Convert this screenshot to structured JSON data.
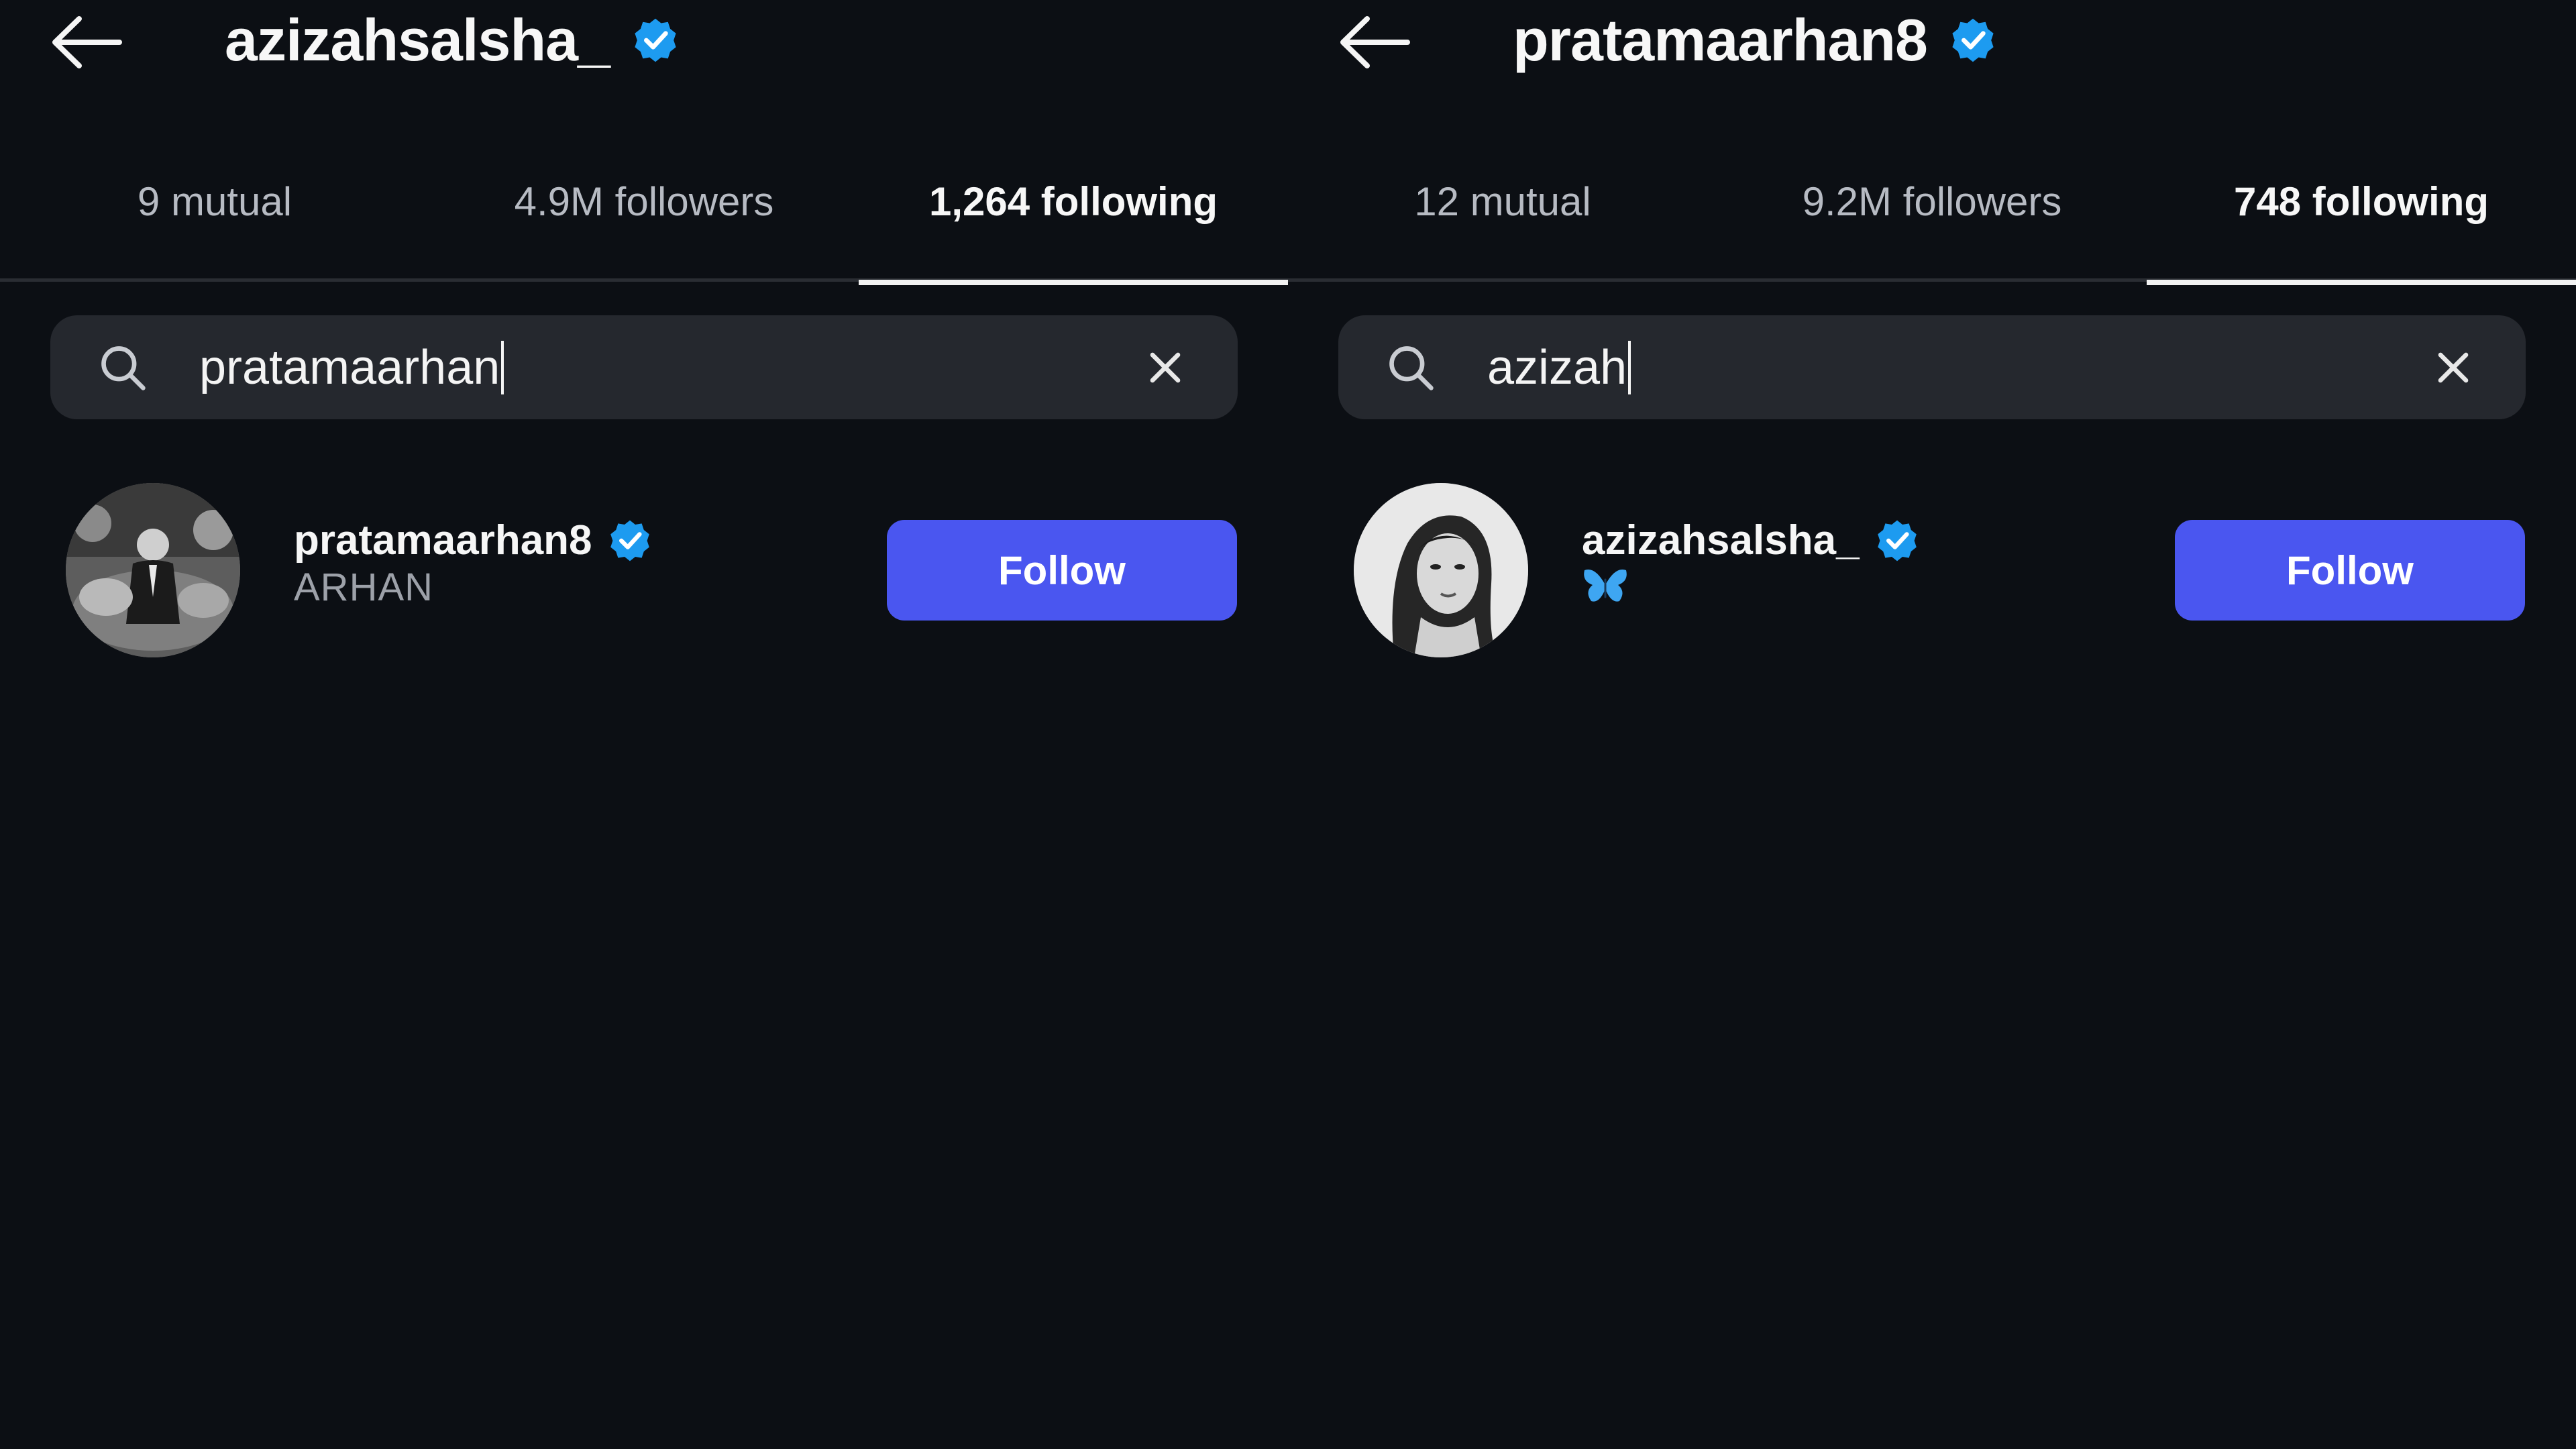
{
  "colors": {
    "background": "#0c0f14",
    "verified": "#1d9bf0",
    "follow_button": "#4a56f0",
    "search_bg": "#25282e"
  },
  "left": {
    "header": {
      "handle": "azizahsalsha_",
      "back_icon": "arrow-left-icon",
      "verified_icon": "verified-badge-icon"
    },
    "tabs": [
      {
        "label": "9 mutual",
        "active": false
      },
      {
        "label": "4.9M followers",
        "active": false
      },
      {
        "label": "1,264 following",
        "active": true
      }
    ],
    "search": {
      "value": "pratamaarhan",
      "icon": "search-icon",
      "clear_icon": "close-icon"
    },
    "result": {
      "name": "pratamaarhan8",
      "subtitle": "ARHAN",
      "button": "Follow"
    }
  },
  "right": {
    "header": {
      "handle": "pratamaarhan8",
      "back_icon": "arrow-left-icon",
      "verified_icon": "verified-badge-icon"
    },
    "tabs": [
      {
        "label": "12 mutual",
        "active": false
      },
      {
        "label": "9.2M followers",
        "active": false
      },
      {
        "label": "748 following",
        "active": true
      }
    ],
    "search": {
      "value": "azizah",
      "icon": "search-icon",
      "clear_icon": "close-icon"
    },
    "result": {
      "name": "azizahsalsha_",
      "subtitle_icon": "butterfly-icon",
      "button": "Follow"
    }
  }
}
